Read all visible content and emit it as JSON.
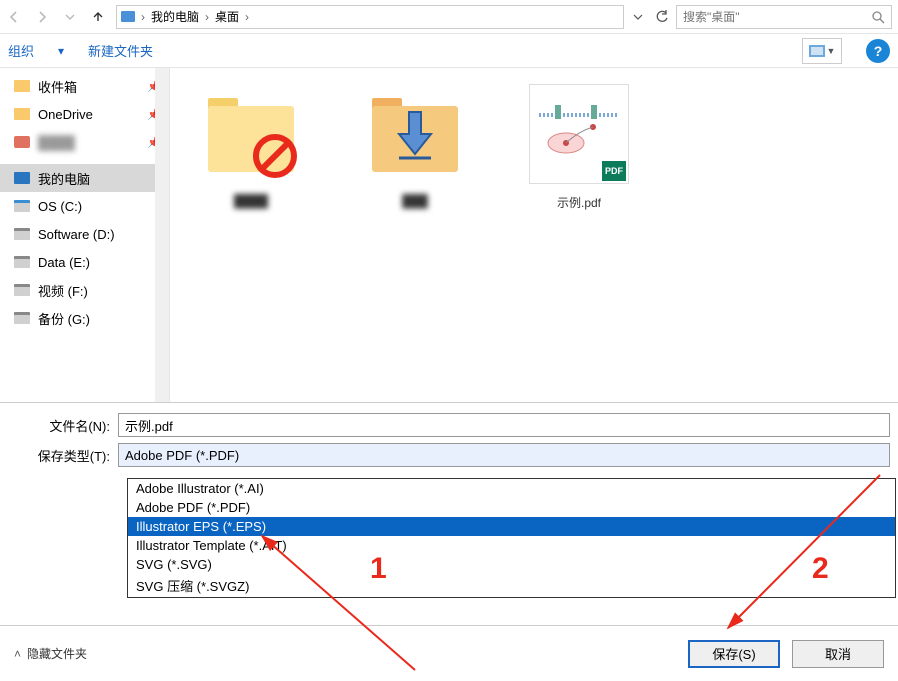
{
  "nav": {
    "breadcrumb": [
      "我的电脑",
      "桌面"
    ],
    "search_placeholder": "搜索\"桌面\""
  },
  "toolbar": {
    "organize": "组织",
    "newfolder": "新建文件夹"
  },
  "sidebar": {
    "items": [
      {
        "label": "收件箱",
        "icon": "folder",
        "pinned": true
      },
      {
        "label": "OneDrive",
        "icon": "folder",
        "pinned": true
      },
      {
        "label": "",
        "icon": "blur",
        "pinned": true
      }
    ],
    "pc_label": "我的电脑",
    "drives": [
      {
        "label": "OS (C:)",
        "icon": "drive-c"
      },
      {
        "label": "Software (D:)",
        "icon": "drive"
      },
      {
        "label": "Data (E:)",
        "icon": "drive"
      },
      {
        "label": "视频 (F:)",
        "icon": "drive"
      },
      {
        "label": "备份 (G:)",
        "icon": "drive"
      }
    ]
  },
  "content": {
    "items": [
      {
        "name": "",
        "kind": "folder-blocked"
      },
      {
        "name": "",
        "kind": "folder-download"
      },
      {
        "name": "示例.pdf",
        "kind": "pdf-image"
      }
    ]
  },
  "fields": {
    "filename_label": "文件名(N):",
    "filename_value": "示例.pdf",
    "filetype_label": "保存类型(T):",
    "filetype_value": "Adobe PDF (*.PDF)"
  },
  "dropdown": {
    "options": [
      "Adobe Illustrator (*.AI)",
      "Adobe PDF (*.PDF)",
      "Illustrator EPS (*.EPS)",
      "Illustrator Template (*.AIT)",
      "SVG (*.SVG)",
      "SVG 压缩 (*.SVGZ)"
    ],
    "highlighted_index": 2
  },
  "bottom": {
    "hide_folders": "隐藏文件夹",
    "save": "保存(S)",
    "cancel": "取消"
  },
  "annotations": {
    "num1": "1",
    "num2": "2"
  }
}
